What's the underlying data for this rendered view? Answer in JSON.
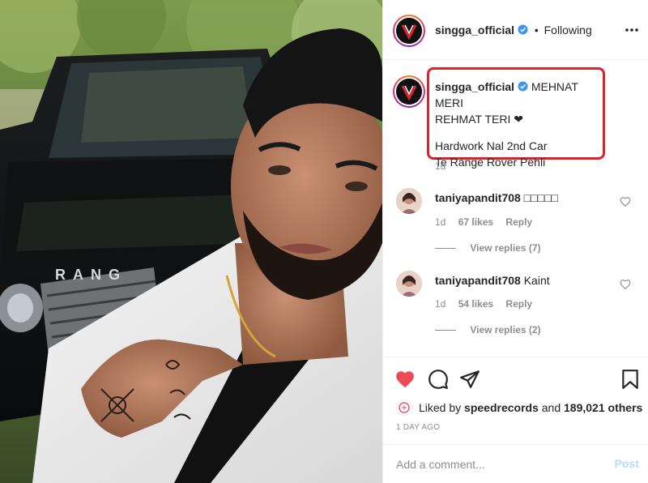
{
  "post": {
    "username": "singga_official",
    "follow_status": "Following",
    "separator": "•",
    "caption_lines": [
      "MEHNAT MERI",
      "REHMAT TERI ❤",
      "Hardwork Nal 2nd Car",
      "Te Range Rover Pehli"
    ],
    "caption_time": "1d",
    "photo_car_badge": "RANG",
    "liked_by_prefix": "Liked by",
    "liked_by_user": "speedrecords",
    "liked_by_joiner": "and",
    "liked_by_count": "189,021 others",
    "post_time": "1 DAY AGO"
  },
  "comments": [
    {
      "username": "taniyapandit708",
      "text": "□□□□□",
      "time": "1d",
      "likes": "67 likes",
      "reply_label": "Reply",
      "view_replies": "View replies (7)"
    },
    {
      "username": "taniyapandit708",
      "text": "Kaint",
      "time": "1d",
      "likes": "54 likes",
      "reply_label": "Reply",
      "view_replies": "View replies (2)"
    }
  ],
  "add_comment": {
    "placeholder": "Add a comment...",
    "post_label": "Post"
  },
  "icons": {
    "like": "heart-filled-icon",
    "comment": "speech-bubble-icon",
    "share": "paper-plane-icon",
    "save": "bookmark-icon",
    "more": "ellipsis-icon",
    "verified": "verified-badge-icon"
  },
  "colors": {
    "like_red": "#ed4956",
    "verified_blue": "#3897f0",
    "highlight_red": "#d9242f",
    "post_button_disabled": "#b3dbff"
  }
}
